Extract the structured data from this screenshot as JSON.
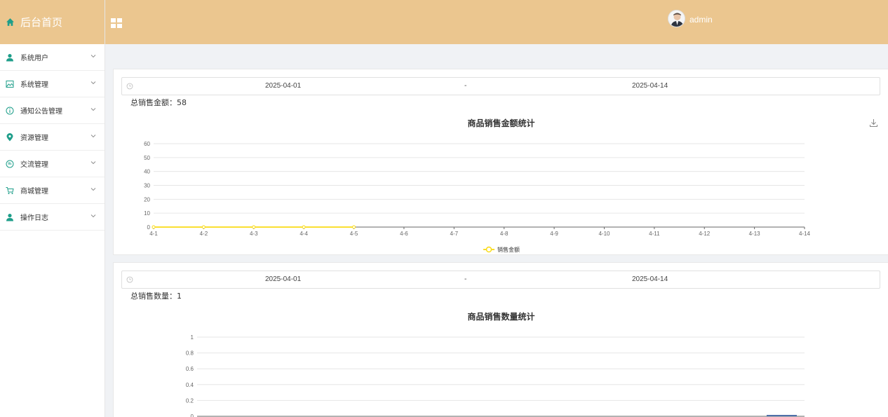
{
  "sidebar": {
    "brand": "后台首页",
    "items": [
      {
        "label": "系统用户",
        "icon": "user-icon"
      },
      {
        "label": "系统管理",
        "icon": "image-icon"
      },
      {
        "label": "通知公告管理",
        "icon": "info-icon"
      },
      {
        "label": "资源管理",
        "icon": "location-pin-icon"
      },
      {
        "label": "交流管理",
        "icon": "chat-icon"
      },
      {
        "label": "商城管理",
        "icon": "cart-icon"
      },
      {
        "label": "操作日志",
        "icon": "user-icon"
      }
    ]
  },
  "topbar": {
    "username": "admin"
  },
  "colors": {
    "header": "#ebc68f",
    "accent": "#1e9e8a",
    "line_series": "#fadb14",
    "bar_series": "#4e6fa8"
  },
  "amount_panel": {
    "start_date": "2025-04-01",
    "separator": "-",
    "end_date": "2025-04-14",
    "total_label": "总销售金额：58"
  },
  "quantity_panel": {
    "start_date": "2025-04-01",
    "separator": "-",
    "end_date": "2025-04-14",
    "total_label": "总销售数量：1"
  },
  "chart_data": [
    {
      "type": "line",
      "title": "商品销售金额统计",
      "categories": [
        "4-1",
        "4-2",
        "4-3",
        "4-4",
        "4-5",
        "4-6",
        "4-7",
        "4-8",
        "4-9",
        "4-10",
        "4-11",
        "4-12",
        "4-13",
        "4-14"
      ],
      "series": [
        {
          "name": "销售金额",
          "values": [
            0,
            0,
            0,
            0,
            0,
            null,
            null,
            null,
            null,
            null,
            null,
            null,
            null,
            null
          ]
        }
      ],
      "yticks": [
        "0",
        "10",
        "20",
        "30",
        "40",
        "50",
        "60"
      ],
      "ylim": [
        0,
        60
      ],
      "grid": true,
      "legend": "bottom"
    },
    {
      "type": "bar",
      "title": "商品销售数量统计",
      "yticks": [
        "0",
        "0.2",
        "0.4",
        "0.6",
        "0.8",
        "1"
      ],
      "ylim": [
        0,
        1
      ],
      "grid": true
    }
  ]
}
